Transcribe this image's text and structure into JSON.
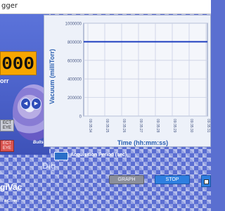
{
  "window": {
    "title": "gger"
  },
  "gauge": {
    "reading": "000",
    "unit": "orr",
    "up_arrow": "◀",
    "down_arrow": "▶",
    "select_buttons": [
      {
        "line1": "ECT",
        "line2": "EYE",
        "active": false
      },
      {
        "line1": "ECT",
        "line2": "EYE",
        "active": true
      }
    ],
    "brand_text": "Bullseye Pr"
  },
  "chart_data": {
    "type": "line",
    "xlabel": "Time (hh:mm:ss)",
    "ylabel": "Vacuum (milliTorr)",
    "ylim": [
      0,
      1000000
    ],
    "y_ticks": [
      "1000000",
      "800000",
      "600000",
      "400000",
      "200000",
      "0"
    ],
    "x_ticks": [
      "09:35:34",
      "09:35:25",
      "09:35:26",
      "09:35:27",
      "09:35:28",
      "09:35:29",
      "09:35:30",
      "09:35:31"
    ],
    "series": [
      {
        "values": [
          800000,
          800000,
          800000,
          800000,
          800000,
          800000,
          800000,
          800000
        ]
      }
    ],
    "grid": true
  },
  "controls": {
    "acquisition_label": "Acquisition Period (sec)",
    "graph_button": "GRAPH",
    "stop_button": "STOP",
    "dig_text": "Dig"
  },
  "branding": {
    "logo": "giVac",
    "tagline": "re & Control"
  },
  "colors": {
    "accent": "#2e7fe0",
    "readout": "#f7a600",
    "line": "#1f3fbf"
  }
}
